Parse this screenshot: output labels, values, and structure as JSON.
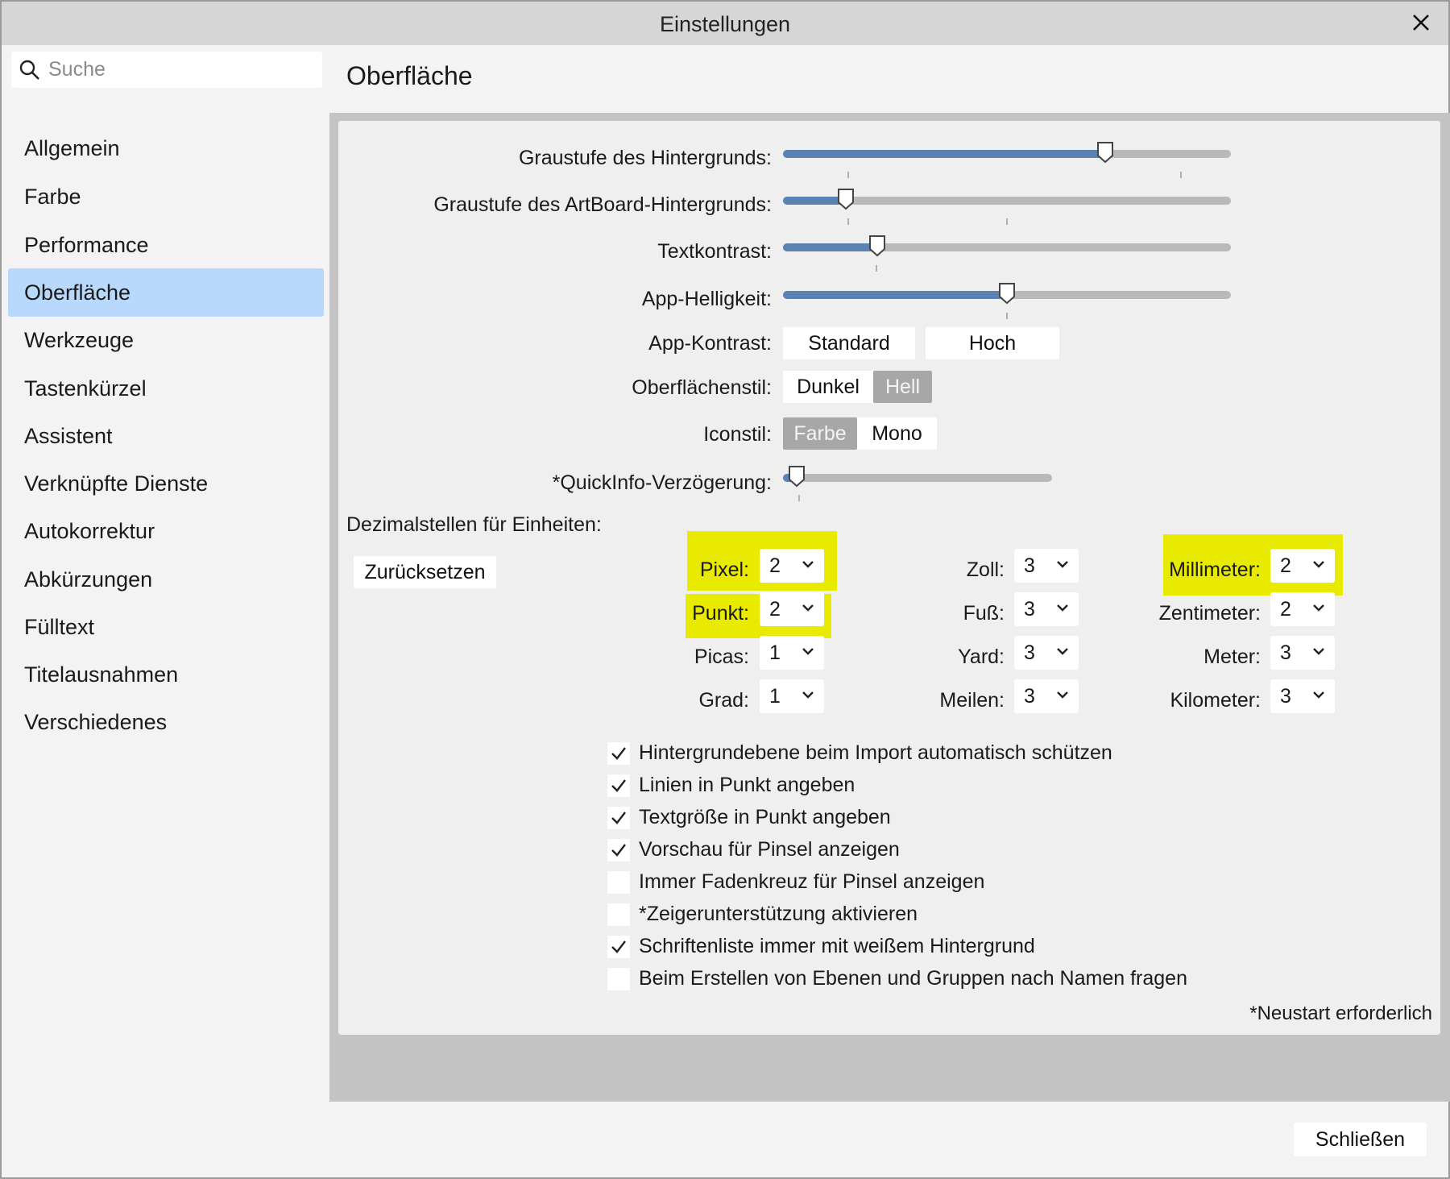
{
  "window": {
    "title": "Einstellungen"
  },
  "search": {
    "placeholder": "Suche"
  },
  "sidebar": {
    "items": [
      {
        "label": "Allgemein"
      },
      {
        "label": "Farbe"
      },
      {
        "label": "Performance"
      },
      {
        "label": "Oberfläche"
      },
      {
        "label": "Werkzeuge"
      },
      {
        "label": "Tastenkürzel"
      },
      {
        "label": "Assistent"
      },
      {
        "label": "Verknüpfte Dienste"
      },
      {
        "label": "Autokorrektur"
      },
      {
        "label": "Abkürzungen"
      },
      {
        "label": "Fülltext"
      },
      {
        "label": "Titelausnahmen"
      },
      {
        "label": "Verschiedenes"
      }
    ],
    "selected": "Oberfläche"
  },
  "page": {
    "title": "Oberfläche"
  },
  "sliders": {
    "background_gray": {
      "label": "Graustufe des Hintergrunds:",
      "value": 0.72
    },
    "artboard_gray": {
      "label": "Graustufe des ArtBoard-Hintergrunds:",
      "value": 0.14
    },
    "text_contrast": {
      "label": "Textkontrast:",
      "value": 0.21
    },
    "app_brightness": {
      "label": "App-Helligkeit:",
      "value": 0.5
    },
    "quickinfo_delay": {
      "label": "*QuickInfo-Verzögerung:",
      "value": 0.05
    }
  },
  "app_contrast": {
    "label": "App-Kontrast:",
    "options": [
      "Standard",
      "Hoch"
    ]
  },
  "surface_style": {
    "label": "Oberflächenstil:",
    "options": [
      "Dunkel",
      "Hell"
    ],
    "selected": "Hell"
  },
  "icon_style": {
    "label": "Iconstil:",
    "options": [
      "Farbe",
      "Mono"
    ],
    "selected": "Farbe"
  },
  "decimals": {
    "heading": "Dezimalstellen für Einheiten:",
    "reset_label": "Zurücksetzen",
    "units": {
      "pixel": {
        "label": "Pixel:",
        "value": "2"
      },
      "punkt": {
        "label": "Punkt:",
        "value": "2"
      },
      "picas": {
        "label": "Picas:",
        "value": "1"
      },
      "grad": {
        "label": "Grad:",
        "value": "1"
      },
      "zoll": {
        "label": "Zoll:",
        "value": "3"
      },
      "fuss": {
        "label": "Fuß:",
        "value": "3"
      },
      "yard": {
        "label": "Yard:",
        "value": "3"
      },
      "meilen": {
        "label": "Meilen:",
        "value": "3"
      },
      "millimeter": {
        "label": "Millimeter:",
        "value": "2"
      },
      "zentimeter": {
        "label": "Zentimeter:",
        "value": "2"
      },
      "meter": {
        "label": "Meter:",
        "value": "3"
      },
      "kilometer": {
        "label": "Kilometer:",
        "value": "3"
      }
    },
    "highlight_color": "#e8ea00"
  },
  "checkboxes": [
    {
      "label": "Hintergrundebene beim Import automatisch schützen",
      "checked": true
    },
    {
      "label": "Linien in Punkt angeben",
      "checked": true
    },
    {
      "label": "Textgröße in Punkt angeben",
      "checked": true
    },
    {
      "label": "Vorschau für Pinsel anzeigen",
      "checked": true
    },
    {
      "label": "Immer Fadenkreuz für Pinsel anzeigen",
      "checked": false
    },
    {
      "label": "*Zeigerunterstützung aktivieren",
      "checked": false
    },
    {
      "label": "Schriftenliste immer mit weißem Hintergrund",
      "checked": true
    },
    {
      "label": "Beim Erstellen von Ebenen und Gruppen nach Namen fragen",
      "checked": false
    }
  ],
  "restart_note": "*Neustart erforderlich",
  "footer": {
    "close_label": "Schließen"
  },
  "colors": {
    "selected_nav": "#b8d9fb",
    "slider_fill": "#5a82b3",
    "active_toggle": "#a7a7a7"
  }
}
